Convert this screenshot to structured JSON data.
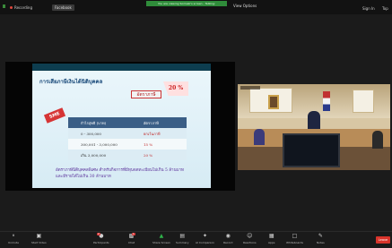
{
  "topbar": {
    "recording": "Recording",
    "facebook": "Facebook",
    "talking": "You are viewing Somsak's screen - Talking:",
    "view_options": "View Options",
    "sign_in": "Sign In",
    "top": "Top"
  },
  "slide": {
    "title": "การเสียภาษีเงินได้นิติบุคคล",
    "rate_label": "อัตราภาษี",
    "rate_value": "20 %",
    "sme": "SME",
    "table_headers": [
      "กำไรสุทธิ (บาท)",
      "อัตราภาษี"
    ],
    "table_rows": [
      [
        "0 - 300,000",
        "ยกเว้นภาษี"
      ],
      [
        "300,001 - 3,000,000",
        "15 %"
      ],
      [
        "เกิน 3,000,000",
        "20 %"
      ]
    ],
    "note": "อัตราภาษีนิติบุคคลพิเศษ สำหรับกิจการที่มีทุนจดทะเบียนไม่เกิน 5 ล้านบาท และมีรายได้ไม่เกิน 30 ล้านบาท"
  },
  "toolbar": {
    "items": [
      "Unmute",
      "Start Video",
      "Participants",
      "Chat",
      "Share Screen",
      "Summary",
      "AI Companion",
      "Record",
      "Reactions",
      "Apps",
      "Whiteboards",
      "Notes"
    ],
    "participants_count": "2",
    "chat_badge": "1",
    "leave": "Leave"
  }
}
